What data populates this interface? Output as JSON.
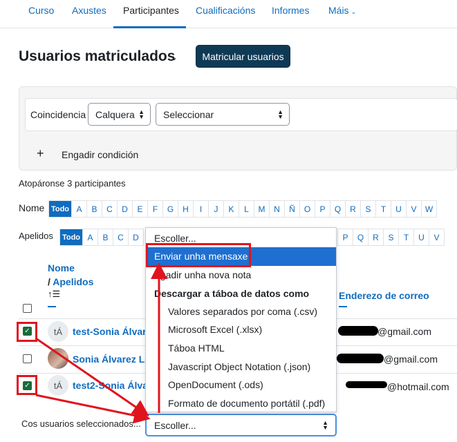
{
  "nav": {
    "items": [
      "Curso",
      "Axustes",
      "Participantes",
      "Cualificacións",
      "Informes",
      "Máis"
    ],
    "active": "Participantes"
  },
  "page": {
    "title": "Usuarios matriculados",
    "enrol_button": "Matricular usuarios"
  },
  "filter": {
    "match_label": "Coincidencia",
    "match_value": "Calquera",
    "type_value": "Seleccionar",
    "add_condition": "Engadir condición"
  },
  "count_text": "Atopáronse 3 participantes",
  "firstname_filter": {
    "label": "Nome",
    "letters": [
      "Todo",
      "A",
      "B",
      "C",
      "D",
      "E",
      "F",
      "G",
      "H",
      "I",
      "J",
      "K",
      "L",
      "M",
      "N",
      "Ñ",
      "O",
      "P",
      "Q",
      "R",
      "S",
      "T",
      "U",
      "V",
      "W"
    ]
  },
  "lastname_filter": {
    "label": "Apelidos",
    "letters_left": [
      "Todo",
      "A",
      "B",
      "C",
      "D"
    ],
    "letters_right": [
      "P",
      "Q",
      "R",
      "S",
      "T",
      "U",
      "V"
    ]
  },
  "table": {
    "col_name": "Nome",
    "col_sep": "/",
    "col_surname": "Apelidos",
    "col_email": "Enderezo de correo",
    "rows": [
      {
        "initials": "tÁ",
        "name": "test-Sonia Álvarez",
        "email": "@gmail.com",
        "checked": true
      },
      {
        "initials": "",
        "name": "Sonia Álvarez López",
        "email": "@gmail.com",
        "checked": false
      },
      {
        "initials": "tÁ",
        "name": "test2-Sonia Álvarez",
        "email": "@hotmail.com",
        "checked": true
      }
    ]
  },
  "bulk": {
    "label": "Cos usuarios seleccionados...",
    "select_value": "Escoller..."
  },
  "menu": {
    "choose": "Escoller...",
    "send_message": "Enviar unha mensaxe",
    "add_note": "ngadir unha nova nota",
    "download_header": "Descargar a táboa de datos como",
    "formats": [
      "Valores separados por coma (.csv)",
      "Microsoft Excel (.xlsx)",
      "Táboa HTML",
      "Javascript Object Notation (.json)",
      "OpenDocument (.ods)",
      "Formato de documento portátil (.pdf)"
    ]
  },
  "colors": {
    "link": "#0f6cbf",
    "primary_dark": "#0f3a55",
    "highlight": "#1e6fd0",
    "annotation": "#e0141e"
  }
}
